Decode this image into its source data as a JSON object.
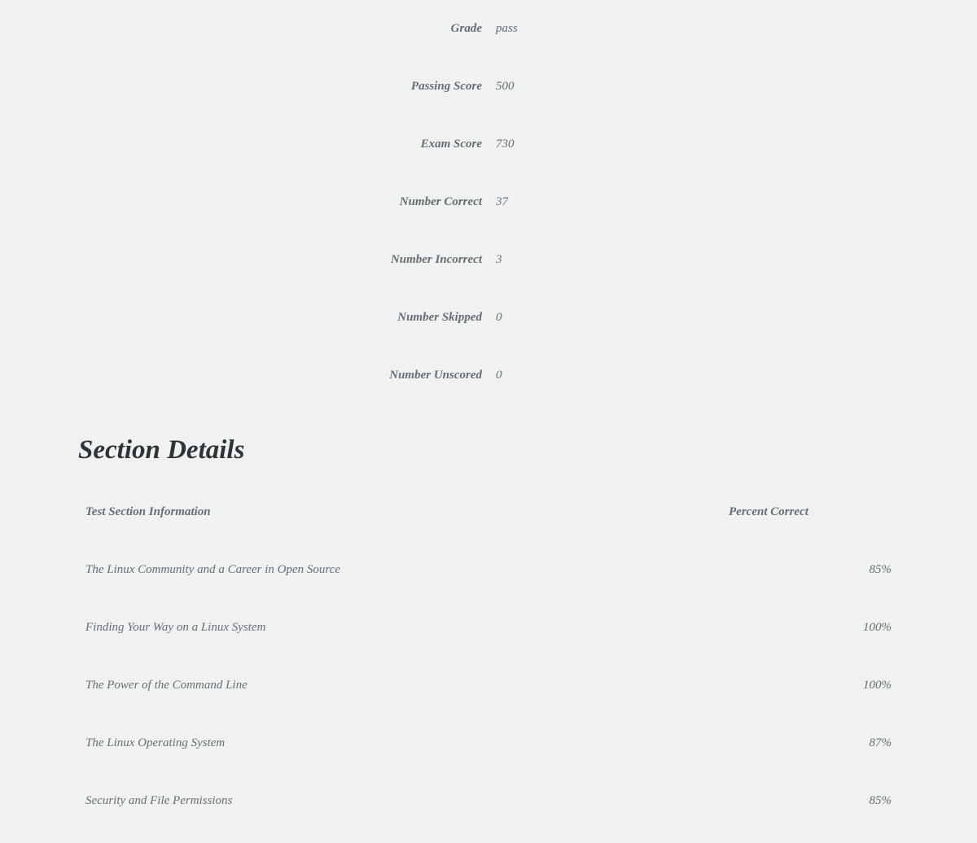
{
  "summary": {
    "rows": [
      {
        "label": "Grade",
        "value": "pass"
      },
      {
        "label": "Passing Score",
        "value": "500"
      },
      {
        "label": "Exam Score",
        "value": "730"
      },
      {
        "label": "Number Correct",
        "value": "37"
      },
      {
        "label": "Number Incorrect",
        "value": "3"
      },
      {
        "label": "Number Skipped",
        "value": "0"
      },
      {
        "label": "Number Unscored",
        "value": "0"
      }
    ]
  },
  "section_details": {
    "heading": "Section Details",
    "header": {
      "section_col": "Test Section Information",
      "percent_col": "Percent Correct"
    },
    "rows": [
      {
        "name": "The Linux Community and a Career in Open Source",
        "percent": "85%"
      },
      {
        "name": "Finding Your Way on a Linux System",
        "percent": "100%"
      },
      {
        "name": "The Power of the Command Line",
        "percent": "100%"
      },
      {
        "name": "The Linux Operating System",
        "percent": "87%"
      },
      {
        "name": "Security and File Permissions",
        "percent": "85%"
      }
    ]
  }
}
